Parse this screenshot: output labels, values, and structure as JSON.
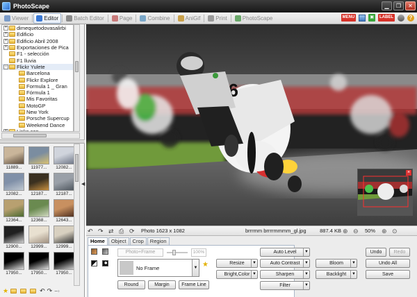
{
  "window": {
    "title": "PhotoScape"
  },
  "main_tabs": [
    {
      "label": "Viewer",
      "color": "#7a9bc8"
    },
    {
      "label": "Editor",
      "color": "#3a78d4",
      "active": true
    },
    {
      "label": "Batch Editor",
      "color": "#8a8a8a"
    },
    {
      "label": "Page",
      "color": "#c87a7a"
    },
    {
      "label": "Combine",
      "color": "#7aa7c8"
    },
    {
      "label": "AniGif",
      "color": "#c8a04a"
    },
    {
      "label": "Print",
      "color": "#9a9a9a"
    },
    {
      "label": "PhotoScape",
      "color": "#6aa86a"
    }
  ],
  "top_badges": {
    "menu": "MENU",
    "skin": "LABEL"
  },
  "folder_tree": [
    {
      "label": "dimequetodovasalirbi",
      "expander": "+",
      "level": 0
    },
    {
      "label": "Edificio",
      "expander": "+",
      "level": 0
    },
    {
      "label": "Edificio Abril 2008",
      "expander": "+",
      "level": 0
    },
    {
      "label": "Exportaciones de Pica",
      "expander": "+",
      "level": 0
    },
    {
      "label": "F1 - selección",
      "expander": "",
      "level": 0
    },
    {
      "label": "F1 lluvia",
      "expander": "",
      "level": 0
    },
    {
      "label": "Flickr Yulete",
      "expander": "−",
      "level": 0,
      "selected": true
    },
    {
      "label": "Barcelona",
      "expander": "",
      "level": 1
    },
    {
      "label": "Flickr Explore",
      "expander": "",
      "level": 1
    },
    {
      "label": "Formula 1 _ Gran",
      "expander": "",
      "level": 1
    },
    {
      "label": "Fórmula 1",
      "expander": "",
      "level": 1
    },
    {
      "label": "Mis Favoritas",
      "expander": "",
      "level": 1
    },
    {
      "label": "MotoGP",
      "expander": "",
      "level": 1
    },
    {
      "label": "New York",
      "expander": "",
      "level": 1
    },
    {
      "label": "Porsche Supercup",
      "expander": "",
      "level": 1
    },
    {
      "label": "Weekend Dance",
      "expander": "",
      "level": 1
    },
    {
      "label": "Links con...",
      "expander": "+",
      "level": 0
    }
  ],
  "thumbnails": [
    {
      "name": "11889...",
      "c1": "#c9b59a",
      "c2": "#5a4a3a"
    },
    {
      "name": "11977...",
      "c1": "#7b8da0",
      "c2": "#d8c070"
    },
    {
      "name": "12082...",
      "c1": "#d0d4dc",
      "c2": "#707888"
    },
    {
      "name": "12082...",
      "c1": "#8090a8",
      "c2": "#c0c8d0"
    },
    {
      "name": "12187...",
      "c1": "#3a3020",
      "c2": "#c89040"
    },
    {
      "name": "12187...",
      "c1": "#9aa0a8",
      "c2": "#505860"
    },
    {
      "name": "12364...",
      "c1": "#b8a070",
      "c2": "#4a6a30"
    },
    {
      "name": "12368...",
      "c1": "#6a8a50",
      "c2": "#d0d8c0"
    },
    {
      "name": "12643...",
      "c1": "#c89060",
      "c2": "#503020"
    },
    {
      "name": "12900...",
      "c1": "#202020",
      "c2": "#d0d0d0"
    },
    {
      "name": "12999...",
      "c1": "#e8e0d0",
      "c2": "#a09080"
    },
    {
      "name": "12999...",
      "c1": "#d8d0c0",
      "c2": "#303030"
    },
    {
      "name": "17950...",
      "c1": "#000000",
      "c2": "#dcdcdc"
    },
    {
      "name": "17950...",
      "c1": "#000000",
      "c2": "#e0e0e0"
    },
    {
      "name": "17950...",
      "c1": "#000000",
      "c2": "#cfcfcf"
    }
  ],
  "status": {
    "photo_size": "Photo 1623 x 1082",
    "filename": "brrrmm brrrrmmmm_gl.jpg",
    "filesize": "887.4 KB",
    "zoom": "50%"
  },
  "edit_tabs": [
    {
      "label": "Home",
      "active": true
    },
    {
      "label": "Object"
    },
    {
      "label": "Crop"
    },
    {
      "label": "Region"
    }
  ],
  "home": {
    "photo_frame": "Photo+Frame",
    "percent": "100%",
    "frame_name": "No Frame",
    "round": "Round",
    "margin": "Margin",
    "frame_line": "Frame Line"
  },
  "filters": {
    "resize": "Resize",
    "bright_color": "Bright,Color",
    "auto_level": "Auto Level",
    "auto_contrast": "Auto Contrast",
    "sharpen": "Sharpen",
    "filter": "Filter",
    "bloom": "Bloom",
    "backlight": "Backlight"
  },
  "history": {
    "undo": "Undo",
    "redo": "Redo",
    "undo_all": "Undo All",
    "save": "Save"
  }
}
